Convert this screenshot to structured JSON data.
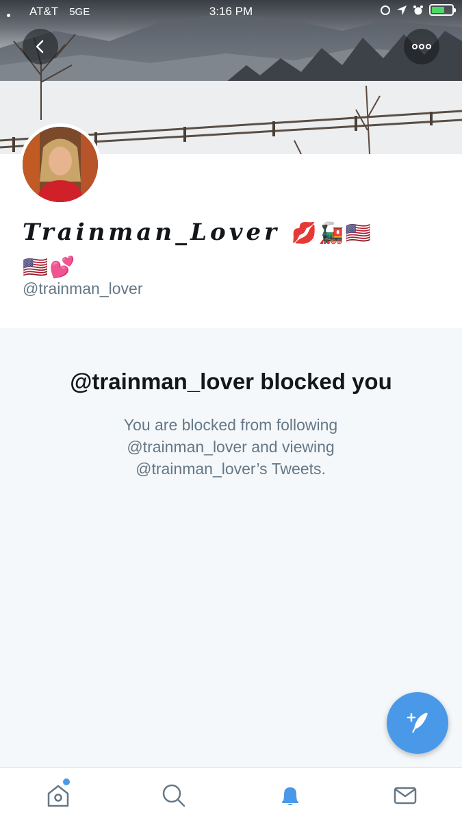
{
  "status_bar": {
    "carrier": "AT&T",
    "network": "5GE",
    "time": "3:16 PM"
  },
  "profile": {
    "display_name": "Trainman_Lover",
    "display_emojis_line1": "💋🚂🇺🇸",
    "display_emojis_line2": "🇺🇸💕",
    "handle": "@trainman_lover"
  },
  "blocked": {
    "title": "@trainman_lover blocked you",
    "description": "You are blocked from following @trainman_lover and viewing @trainman_lover’s Tweets."
  },
  "icons": {
    "back": "back-icon",
    "more": "more-icon",
    "compose": "compose-tweet-icon",
    "home": "home-icon",
    "search": "search-icon",
    "notifications": "bell-icon",
    "messages": "envelope-icon"
  },
  "colors": {
    "accent": "#4a99e9",
    "text_primary": "#14171a",
    "text_secondary": "#657786",
    "background": "#f5f8fa"
  }
}
